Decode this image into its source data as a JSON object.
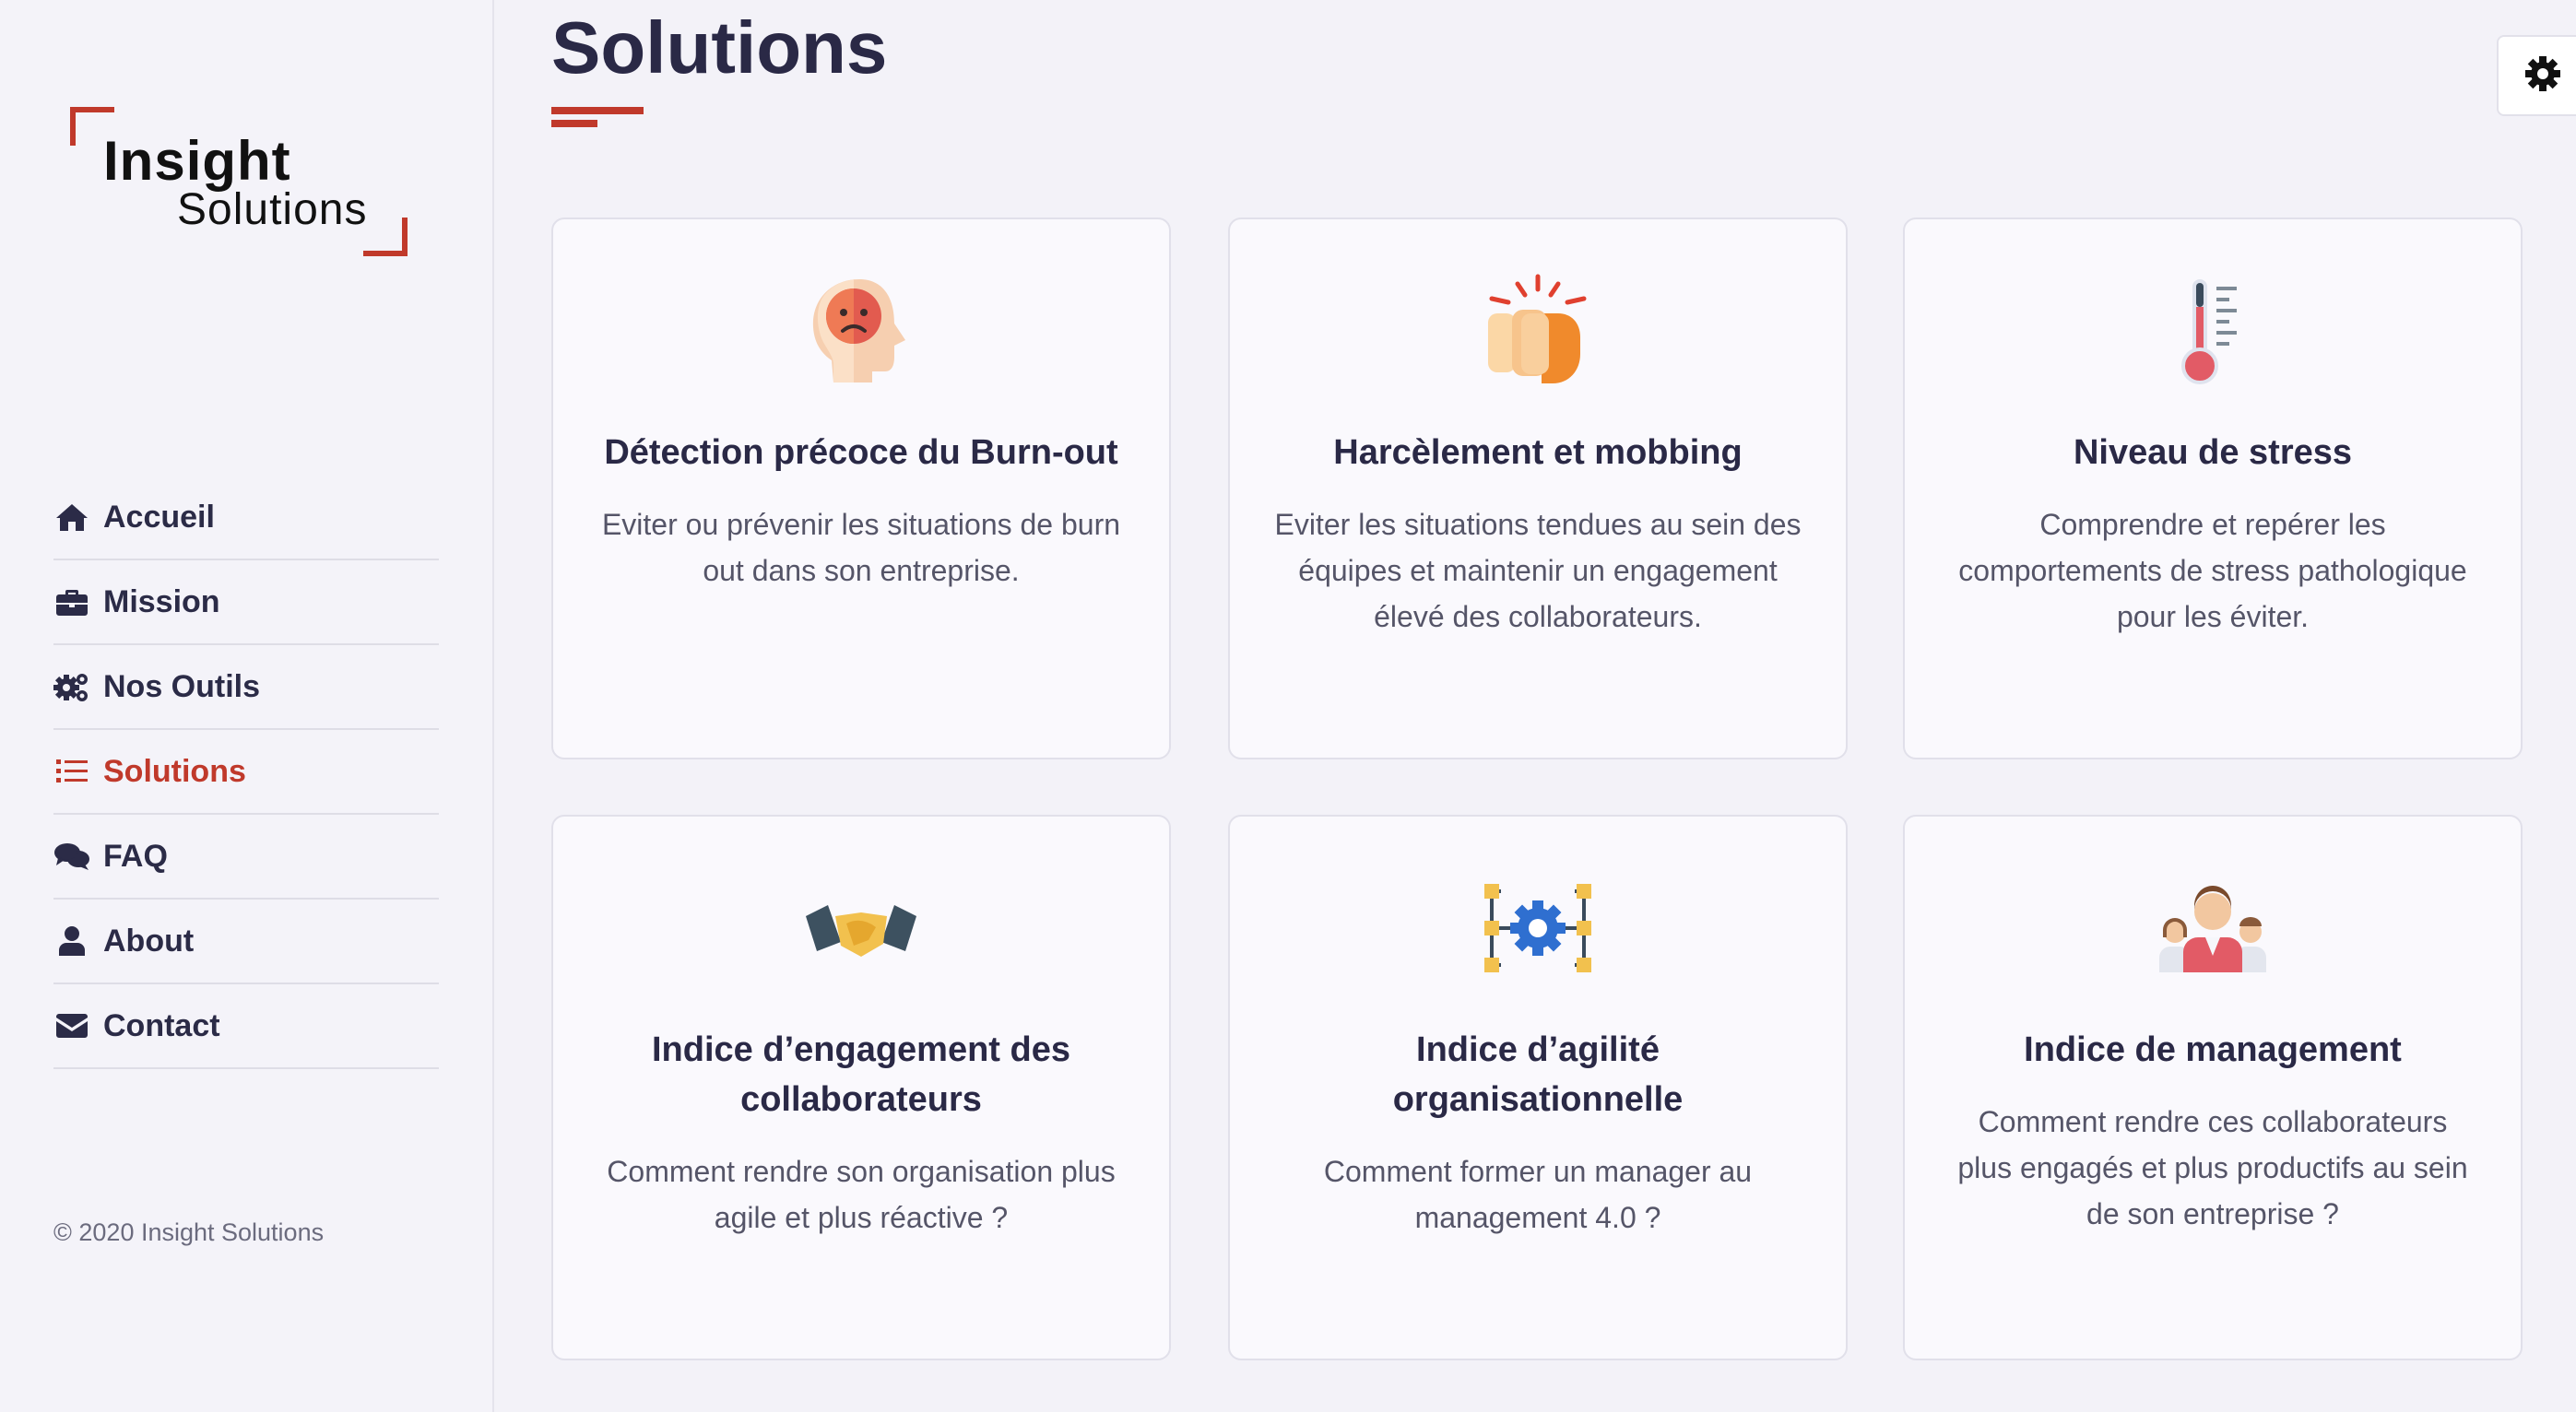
{
  "brand": {
    "line1": "Insight",
    "line2": "Solutions",
    "accent_color": "#c0392b"
  },
  "nav": {
    "items": [
      {
        "label": "Accueil",
        "icon": "home-icon"
      },
      {
        "label": "Mission",
        "icon": "briefcase-icon"
      },
      {
        "label": "Nos Outils",
        "icon": "gears-icon"
      },
      {
        "label": "Solutions",
        "icon": "list-icon",
        "active": true
      },
      {
        "label": "FAQ",
        "icon": "comments-icon"
      },
      {
        "label": "About",
        "icon": "user-icon"
      },
      {
        "label": "Contact",
        "icon": "envelope-icon"
      }
    ]
  },
  "footer": {
    "copyright": "© 2020 Insight Solutions"
  },
  "page": {
    "title": "Solutions"
  },
  "settings": {
    "icon": "gear-icon"
  },
  "cards": [
    {
      "title": "Détection précoce du Burn-out",
      "text": "Eviter ou prévenir les situations de burn out dans son entreprise.",
      "icon": "head-sad-face-icon"
    },
    {
      "title": "Harcèlement et mobbing",
      "text": "Eviter les situations tendues au sein des équipes et maintenir un engagement élevé des collaborateurs.",
      "icon": "punching-fist-icon"
    },
    {
      "title": "Niveau de stress",
      "text": "Comprendre et repérer les comportements de stress pathologique pour les éviter.",
      "icon": "thermometer-icon"
    },
    {
      "title": "Indice d’engagement des collaborateurs",
      "text": "Comment rendre son organisation plus agile et plus réactive ?",
      "icon": "handshake-icon"
    },
    {
      "title": "Indice d’agilité organisationnelle",
      "text": "Comment former un manager au management 4.0 ?",
      "icon": "gear-network-icon"
    },
    {
      "title": "Indice de management",
      "text": "Comment rendre ces collaborateurs plus engagés et plus productifs au sein de son entreprise ?",
      "icon": "team-icon"
    }
  ]
}
